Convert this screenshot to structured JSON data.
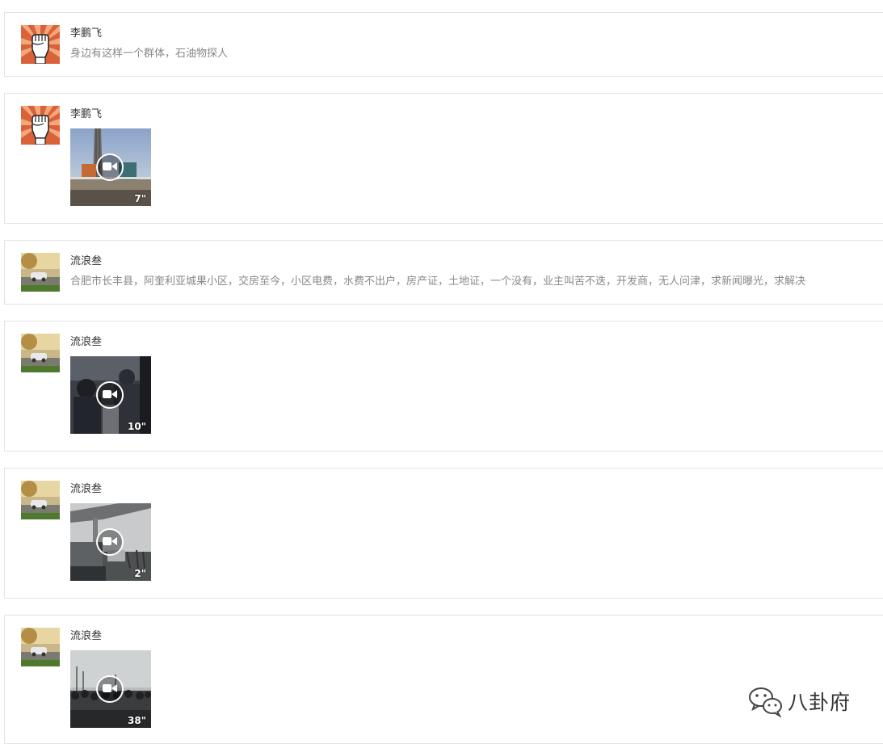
{
  "feed": {
    "items": [
      {
        "user": "李鹏飞",
        "avatar": "raised-fist-icon",
        "type": "text",
        "text": "身边有这样一个群体，石油物探人"
      },
      {
        "user": "李鹏飞",
        "avatar": "raised-fist-icon",
        "type": "video",
        "duration": "7\"",
        "thumb": "drilling-rig"
      },
      {
        "user": "流浪叁",
        "avatar": "car-photo",
        "type": "text",
        "text": "合肥市长丰县，阿奎利亚城果小区，交房至今，小区电费，水费不出户，房产证，土地证，一个没有，业主叫苦不迭，开发商，无人问津，求新闻曝光，求解决"
      },
      {
        "user": "流浪叁",
        "avatar": "car-photo",
        "type": "video",
        "duration": "10\"",
        "thumb": "crowd-closeup"
      },
      {
        "user": "流浪叁",
        "avatar": "car-photo",
        "type": "video",
        "duration": "2\"",
        "thumb": "overpass-road"
      },
      {
        "user": "流浪叁",
        "avatar": "car-photo",
        "type": "video",
        "duration": "38\"",
        "thumb": "crowd-outdoor"
      }
    ]
  },
  "watermark": {
    "text": "八卦府",
    "icon": "wechat-icon"
  },
  "colors": {
    "card_border": "#e3e3e3",
    "name_text": "#333333",
    "message_text": "#888888"
  }
}
